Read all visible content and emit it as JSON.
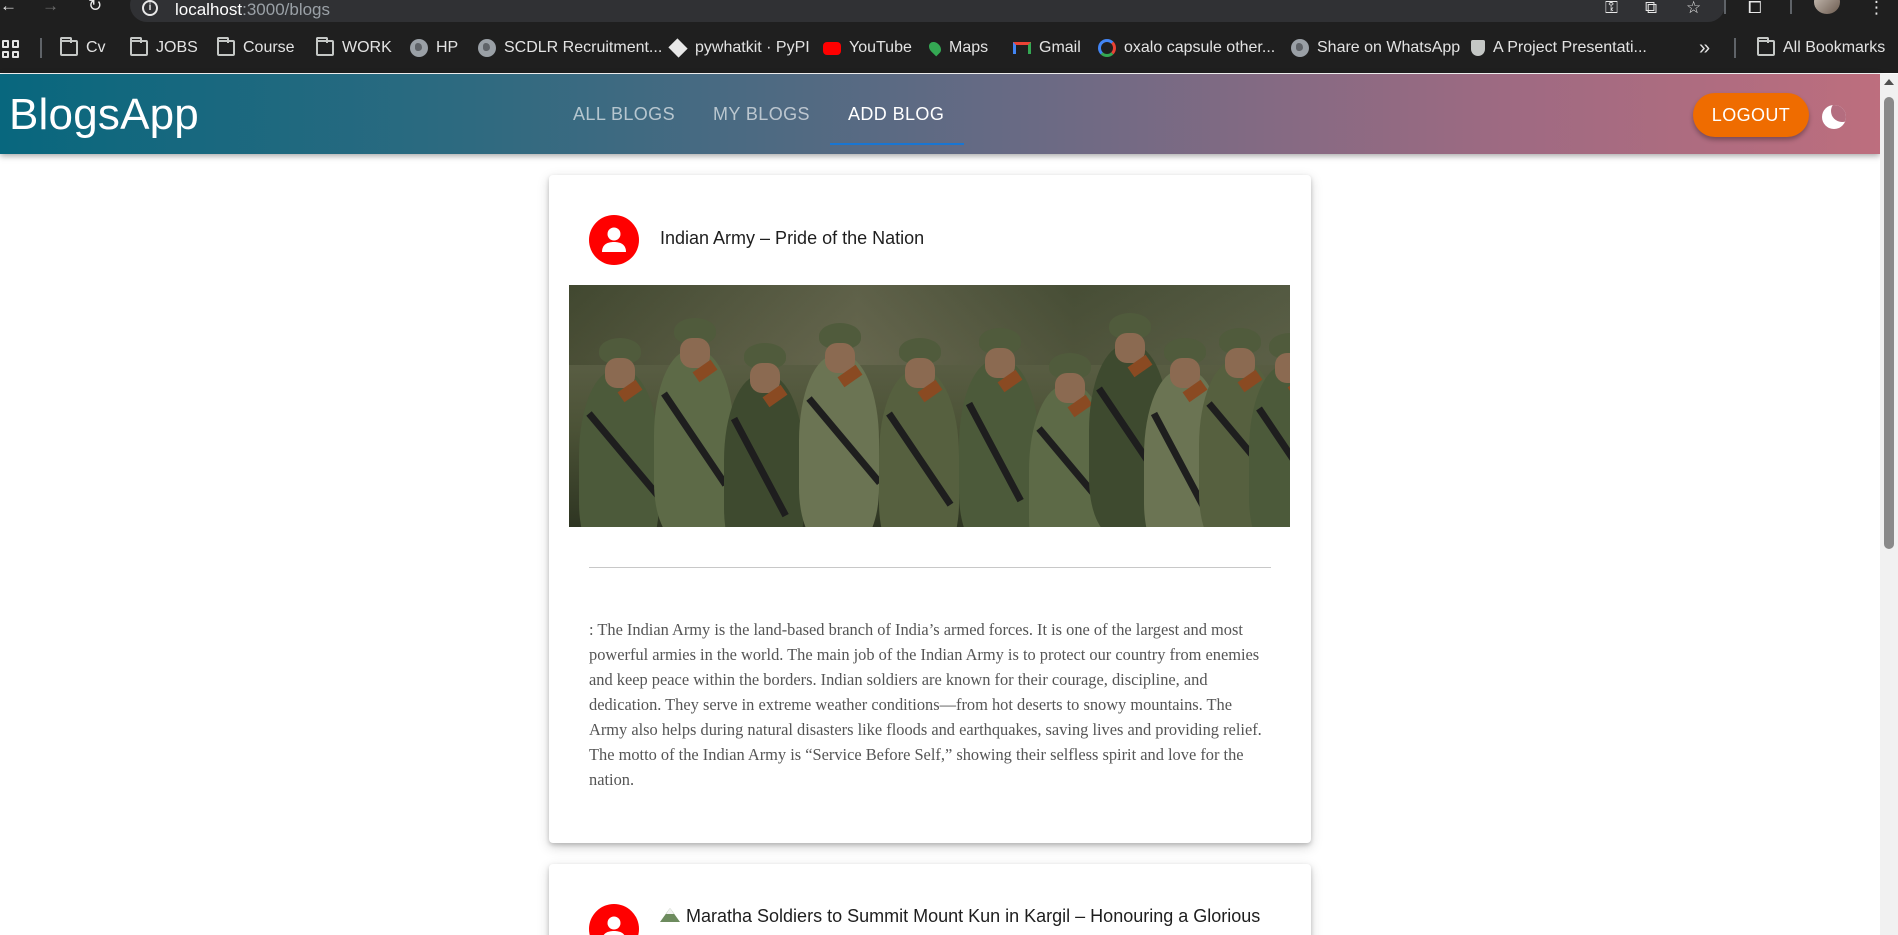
{
  "browser": {
    "url_host": "localhost",
    "url_path": ":3000/blogs",
    "bookmarks": [
      {
        "label": "Cv",
        "icon": "folder-icon"
      },
      {
        "label": "JOBS",
        "icon": "folder-icon"
      },
      {
        "label": "Course",
        "icon": "folder-icon"
      },
      {
        "label": "WORK",
        "icon": "folder-icon"
      },
      {
        "label": "HP",
        "icon": "globe-icon"
      },
      {
        "label": "SCDLR Recruitment...",
        "icon": "globe-icon"
      },
      {
        "label": "pywhatkit · PyPI",
        "icon": "pypi-icon"
      },
      {
        "label": "YouTube",
        "icon": "youtube-icon"
      },
      {
        "label": "Maps",
        "icon": "maps-icon"
      },
      {
        "label": "Gmail",
        "icon": "gmail-icon"
      },
      {
        "label": "oxalo capsule other...",
        "icon": "google-icon"
      },
      {
        "label": "Share on WhatsApp",
        "icon": "globe-icon"
      },
      {
        "label": "A Project Presentati...",
        "icon": "shield-icon"
      }
    ],
    "overflow_label": "»",
    "all_bookmarks": "All Bookmarks"
  },
  "app": {
    "brand": "BlogsApp",
    "tabs": [
      {
        "label": "All Blogs",
        "active": false
      },
      {
        "label": "My Blogs",
        "active": false
      },
      {
        "label": "Add Blog",
        "active": true
      }
    ],
    "logout_label": "Logout",
    "theme_icon": "moon-icon",
    "accent_color": "#ef6c00",
    "avatar_color": "#ff0000"
  },
  "blogs": [
    {
      "title": "Indian Army – Pride of the Nation",
      "image_alt": "Indian Army soldiers marching with rifles",
      "description": ": The Indian Army is the land-based branch of India’s armed forces. It is one of the largest and most powerful armies in the world. The main job of the Indian Army is to protect our country from enemies and keep peace within the borders. Indian soldiers are known for their courage, discipline, and dedication. They serve in extreme weather conditions—from hot deserts to snowy mountains. The Army also helps during natural disasters like floods and earthquakes, saving lives and providing relief. The motto of the Indian Army is “Service Before Self,” showing their selfless spirit and love for the nation."
    },
    {
      "title": "Maratha Soldiers to Summit Mount Kun in Kargil – Honouring a Glorious"
    }
  ]
}
